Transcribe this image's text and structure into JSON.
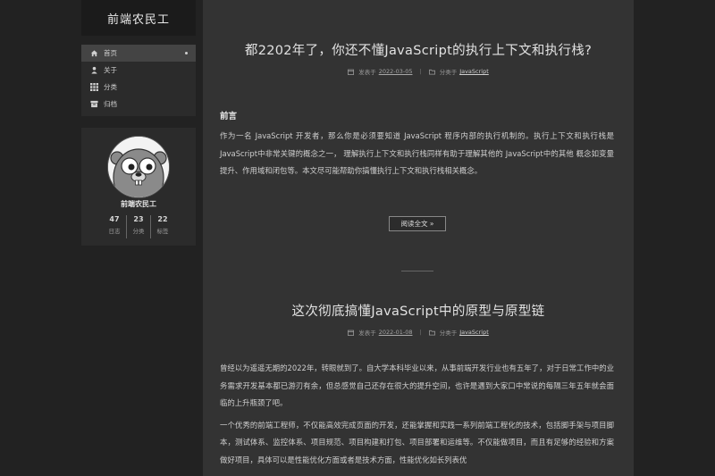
{
  "site": {
    "title": "前端农民工"
  },
  "menu": [
    {
      "label": "首页",
      "icon": "home-icon",
      "active": true
    },
    {
      "label": "关于",
      "icon": "user-icon",
      "active": false
    },
    {
      "label": "分类",
      "icon": "grid-icon",
      "active": false
    },
    {
      "label": "归档",
      "icon": "archive-icon",
      "active": false
    }
  ],
  "author": {
    "name": "前端农民工",
    "stats": [
      {
        "num": "47",
        "label": "日志"
      },
      {
        "num": "23",
        "label": "分类"
      },
      {
        "num": "22",
        "label": "标签"
      }
    ]
  },
  "posts": [
    {
      "title": "都2202年了，你还不懂JavaScript的执行上下文和执行栈?",
      "meta": {
        "posted_label": "发表于",
        "date": "2022-03-05",
        "category_label": "分类于",
        "category": "JavaScript"
      },
      "heading": "前言",
      "paragraphs": [
        "作为一名 JavaScript 开发者，那么你是必须要知道 JavaScript 程序内部的执行机制的。执行上下文和执行栈是JavaScript中非常关键的概念之一，  理解执行上下文和执行栈同样有助于理解其他的 JavaScript中的其他 概念如变量提升、作用域和闭包等。本文尽可能帮助你搞懂执行上下文和执行栈相关概念。"
      ],
      "read_more": "阅读全文 »"
    },
    {
      "title": "这次彻底搞懂JavaScript中的原型与原型链",
      "meta": {
        "posted_label": "发表于",
        "date": "2022-01-08",
        "category_label": "分类于",
        "category": "JavaScript"
      },
      "paragraphs": [
        "曾经以为遥遥无期的2022年，转眼就到了。自大学本科毕业以来，从事前端开发行业也有五年了，对于日常工作中的业务需求开发基本都已游刃有余，但总感觉自己还存在很大的提升空间，也许是遇到大家口中常说的每隔三年五年就会面临的上升瓶颈了吧。",
        "一个优秀的前端工程师，不仅能高效完成页面的开发，还能掌握和实践一系列前端工程化的技术，包括脚手架与项目脚本，测试体系、监控体系、项目规范、项目构建和打包、项目部署和运维等。不仅能做项目，而且有足够的经验和方案做好项目，具体可以是性能优化方面或者是技术方面，性能优化如长列表优"
      ]
    }
  ]
}
